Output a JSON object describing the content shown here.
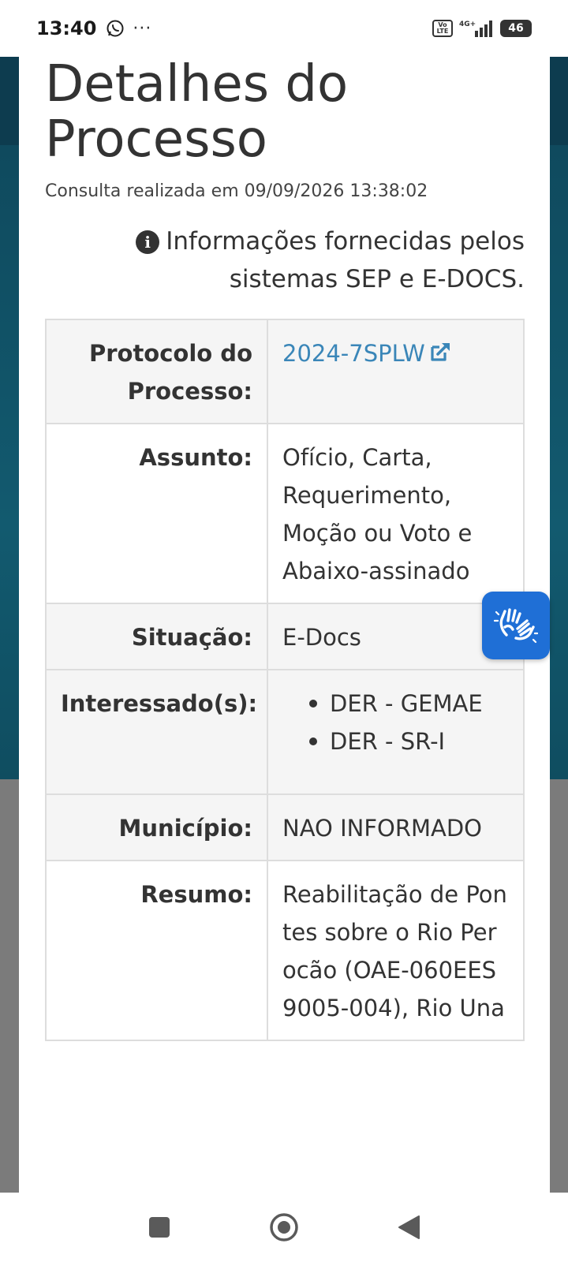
{
  "status_bar": {
    "time": "13:40",
    "more": "···",
    "volte": "Vo LTE",
    "network": "4G+",
    "battery": "46"
  },
  "page": {
    "title": "Detalhes do Processo",
    "query_info": "Consulta realizada em 09/09/2026 13:38:02",
    "source_note": "Informações fornecidas pelos sistemas SEP e E-DOCS."
  },
  "details": {
    "protocol_label": "Protocolo do Processo:",
    "protocol_value": "2024-7SPLW",
    "subject_label": "Assunto:",
    "subject_value": "Ofício, Carta, Requerimento, Moção ou Voto e Abaixo-assinado",
    "status_label": "Situação:",
    "status_value": "E-Docs",
    "interested_label": "Interessado(s):",
    "interested": [
      "DER - GEMAE",
      "DER - SR-I"
    ],
    "municipality_label": "Município:",
    "municipality_value": "NAO INFORMADO",
    "summary_label": "Resumo:",
    "summary_value": "Reabilitação de Pontes sobre o Rio Perocão (OAE-060EES9005-004), Rio Una"
  },
  "icons": {
    "info": "info-circle-icon",
    "external_link": "external-link-icon",
    "accessibility": "sign-language-hands-icon"
  },
  "colors": {
    "link": "#3a86b8",
    "accessibility_button": "#1f6fd6",
    "header_bg": "#0d3c4f"
  }
}
